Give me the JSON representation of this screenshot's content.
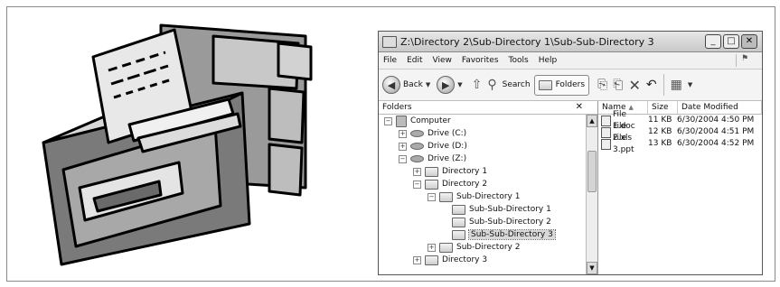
{
  "window": {
    "title": "Z:\\Directory 2\\Sub-Directory 1\\Sub-Sub-Directory 3"
  },
  "menu": [
    "File",
    "Edit",
    "View",
    "Favorites",
    "Tools",
    "Help"
  ],
  "toolbar": {
    "back": "Back",
    "search": "Search",
    "folders": "Folders"
  },
  "folders_pane": {
    "header": "Folders",
    "tree": [
      {
        "label": "Computer",
        "level": 0,
        "expander": "−",
        "icon": "pc"
      },
      {
        "label": "Drive (C:)",
        "level": 1,
        "expander": "+",
        "icon": "drive"
      },
      {
        "label": "Drive (D:)",
        "level": 1,
        "expander": "+",
        "icon": "drive"
      },
      {
        "label": "Drive (Z:)",
        "level": 1,
        "expander": "−",
        "icon": "drive"
      },
      {
        "label": "Directory 1",
        "level": 2,
        "expander": "+",
        "icon": "folder"
      },
      {
        "label": "Directory 2",
        "level": 2,
        "expander": "−",
        "icon": "folder"
      },
      {
        "label": "Sub-Directory 1",
        "level": 3,
        "expander": "−",
        "icon": "folder"
      },
      {
        "label": "Sub-Sub-Directory 1",
        "level": 4,
        "expander": "",
        "icon": "folder"
      },
      {
        "label": "Sub-Sub-Directory 2",
        "level": 4,
        "expander": "",
        "icon": "folder"
      },
      {
        "label": "Sub-Sub-Directory 3",
        "level": 4,
        "expander": "",
        "icon": "folder",
        "selected": true
      },
      {
        "label": "Sub-Directory 2",
        "level": 3,
        "expander": "+",
        "icon": "folder"
      },
      {
        "label": "Directory 3",
        "level": 2,
        "expander": "+",
        "icon": "folder"
      }
    ]
  },
  "files_pane": {
    "columns": {
      "name": "Name",
      "size": "Size",
      "date": "Date Modified"
    },
    "files": [
      {
        "name": "File 1.doc",
        "size": "11 KB",
        "date": "6/30/2004 4:50 PM"
      },
      {
        "name": "File 2.xls",
        "size": "12 KB",
        "date": "6/30/2004 4:51 PM"
      },
      {
        "name": "File 3.ppt",
        "size": "13 KB",
        "date": "6/30/2004 4:52 PM"
      }
    ]
  }
}
